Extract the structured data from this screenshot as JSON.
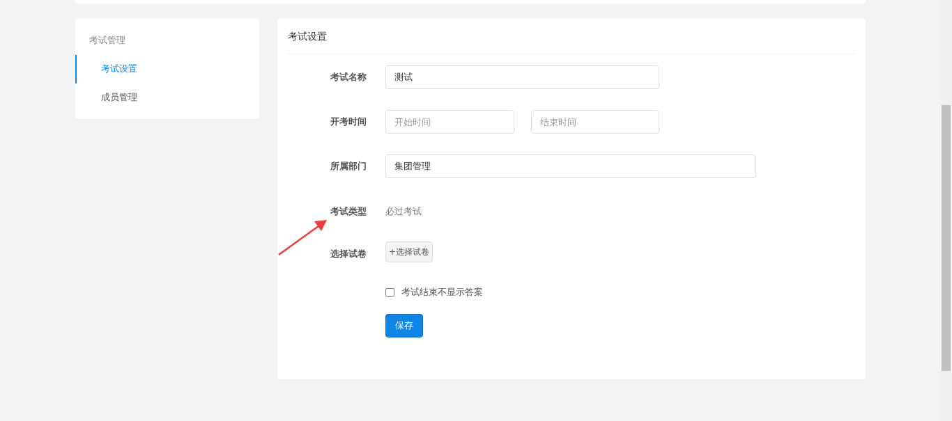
{
  "sidebar": {
    "title": "考试管理",
    "items": [
      {
        "label": "考试设置",
        "selected": true
      },
      {
        "label": "成员管理",
        "selected": false
      }
    ]
  },
  "panel": {
    "title": "考试设置",
    "exam_name": {
      "label": "考试名称",
      "value": "测试"
    },
    "exam_time": {
      "label": "开考时间",
      "start_placeholder": "开始时间",
      "end_placeholder": "结束时间"
    },
    "department": {
      "label": "所属部门",
      "value": "集团管理"
    },
    "exam_type": {
      "label": "考试类型",
      "value": "必过考试"
    },
    "paper": {
      "label": "选择试卷",
      "button": "+选择试卷"
    },
    "hide_answers": {
      "label": "考试结束不显示答案",
      "checked": false
    },
    "save_button": "保存"
  }
}
